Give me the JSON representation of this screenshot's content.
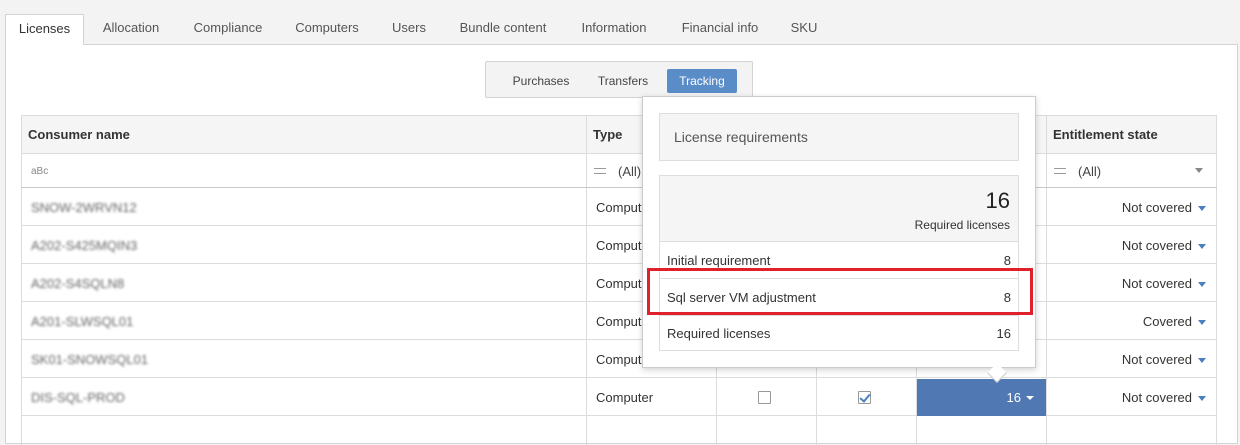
{
  "top_tabs": [
    {
      "label": "Licenses",
      "active": true
    },
    {
      "label": "Allocation"
    },
    {
      "label": "Compliance"
    },
    {
      "label": "Computers"
    },
    {
      "label": "Users"
    },
    {
      "label": "Bundle content"
    },
    {
      "label": "Information"
    },
    {
      "label": "Financial info"
    },
    {
      "label": "SKU"
    }
  ],
  "sub_tabs": [
    {
      "label": "Purchases"
    },
    {
      "label": "Transfers"
    },
    {
      "label": "Tracking",
      "active": true
    }
  ],
  "grid": {
    "headers": {
      "consumer_name": "Consumer name",
      "type": "Type",
      "entitlement_state": "Entitlement state"
    },
    "filters": {
      "consumer_icon": "aBc",
      "type_value": "(All)",
      "entitlement_value": "(All)"
    },
    "rows": [
      {
        "name": "SNOW-2WRVN12",
        "type": "Computer",
        "entitlement": "Not covered"
      },
      {
        "name": "A202-S425MQIN3",
        "type": "Computer",
        "entitlement": "Not covered"
      },
      {
        "name": "A202-S4SQLN8",
        "type": "Computer",
        "entitlement": "Not covered"
      },
      {
        "name": "A201-SLWSQL01",
        "type": "Computer",
        "entitlement": "Covered"
      },
      {
        "name": "SK01-SNOWSQL01",
        "type": "Computer",
        "entitlement": "Not covered"
      },
      {
        "name": "DIS-SQL-PROD",
        "type": "Computer",
        "entitlement": "Not covered",
        "selected_value": "16"
      }
    ]
  },
  "popup": {
    "title": "License requirements",
    "summary_number": "16",
    "summary_label": "Required licenses",
    "rows": [
      {
        "label": "Initial requirement",
        "value": "8"
      },
      {
        "label": "Sql server VM adjustment",
        "value": "8"
      },
      {
        "label": "Required licenses",
        "value": "16"
      }
    ]
  },
  "colors": {
    "accent": "#5a8cc8",
    "selected_cell": "#5079b3",
    "highlight": "#e0202a"
  }
}
